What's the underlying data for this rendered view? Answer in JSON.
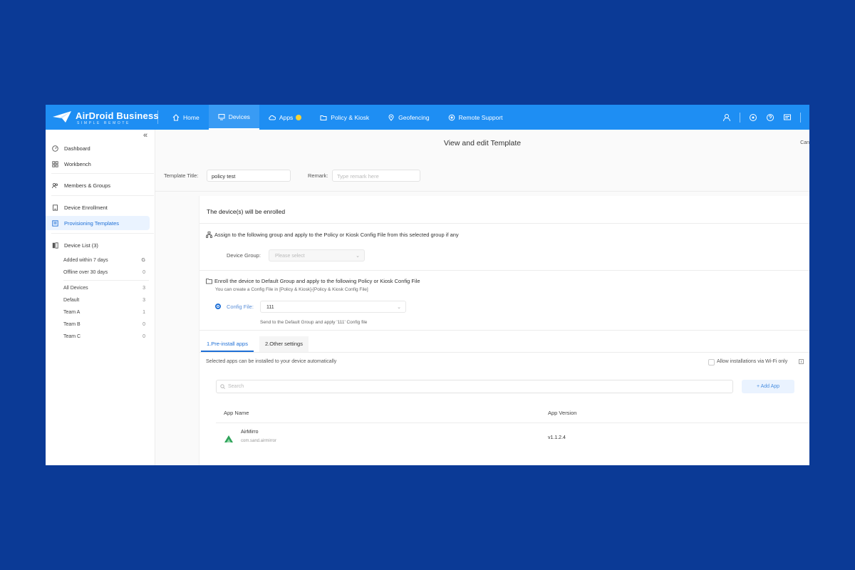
{
  "colors": {
    "page_bg": "#0b3a96",
    "topbar": "#1e8ef3",
    "accent": "#1e6fd6",
    "badge": "#f5d236"
  },
  "brand": {
    "name": "AirDroid Business",
    "sub": "SIMPLE REMOTE"
  },
  "nav": [
    {
      "label": "Home",
      "icon": "home-icon"
    },
    {
      "label": "Devices",
      "icon": "monitor-icon",
      "active": true
    },
    {
      "label": "Apps",
      "icon": "cloud-icon"
    },
    {
      "label": "Policy & Kiosk",
      "icon": "folder-icon"
    },
    {
      "label": "Geofencing",
      "icon": "map-pin-icon"
    },
    {
      "label": "Remote Support",
      "icon": "support-icon"
    }
  ],
  "sidebar": {
    "collapse": "«",
    "items": [
      {
        "label": "Dashboard"
      },
      {
        "label": "Workbench"
      },
      {
        "label": "Members & Groups"
      },
      {
        "label": "Device Enrollment"
      },
      {
        "label": "Provisioning Templates"
      },
      {
        "label": "Device List (3)"
      }
    ],
    "filters": [
      {
        "label": "Added within 7 days",
        "count": "G"
      },
      {
        "label": "Offline over 30 days",
        "count": "0"
      }
    ],
    "groups": [
      {
        "label": "All Devices",
        "count": "3"
      },
      {
        "label": "Default",
        "count": "3"
      },
      {
        "label": "Team A",
        "count": "1"
      },
      {
        "label": "Team B",
        "count": "0"
      },
      {
        "label": "Team C",
        "count": "0"
      }
    ]
  },
  "main": {
    "title": "View and edit Template",
    "cancel": "Can",
    "template_title_label": "Template Title:",
    "template_title_value": "policy test",
    "remark_label": "Remark:",
    "remark_placeholder": "Type remark here",
    "section_title": "The device(s) will be enrolled",
    "option1": "Assign to the following group and apply to the Policy or Kiosk Config File from this selected group if any",
    "device_group_label": "Device Group:",
    "device_group_placeholder": "Please select",
    "option2": "Enroll the device to Default Group and apply to the following Policy or Kiosk Config File",
    "option2_hint": "You can create a Config File in [Policy & Kiosk]-[Policy & Kiosk Config File]",
    "config_file_label": "Config File:",
    "config_file_value": "111",
    "config_hint": "Send to the Default Group and apply '111' Config file",
    "tabs": [
      "1.Pre-install apps",
      "2.Other settings"
    ],
    "apps_desc": "Selected apps can be installed to your device automatically",
    "wifi_only": "Allow installations via Wi-Fi only",
    "search_placeholder": "Search",
    "add_app": "+ Add App",
    "columns": [
      "App Name",
      "App Version"
    ],
    "apps": [
      {
        "name": "AirMirro",
        "package": "com.sand.airmirror",
        "version": "v1.1.2.4"
      }
    ]
  }
}
